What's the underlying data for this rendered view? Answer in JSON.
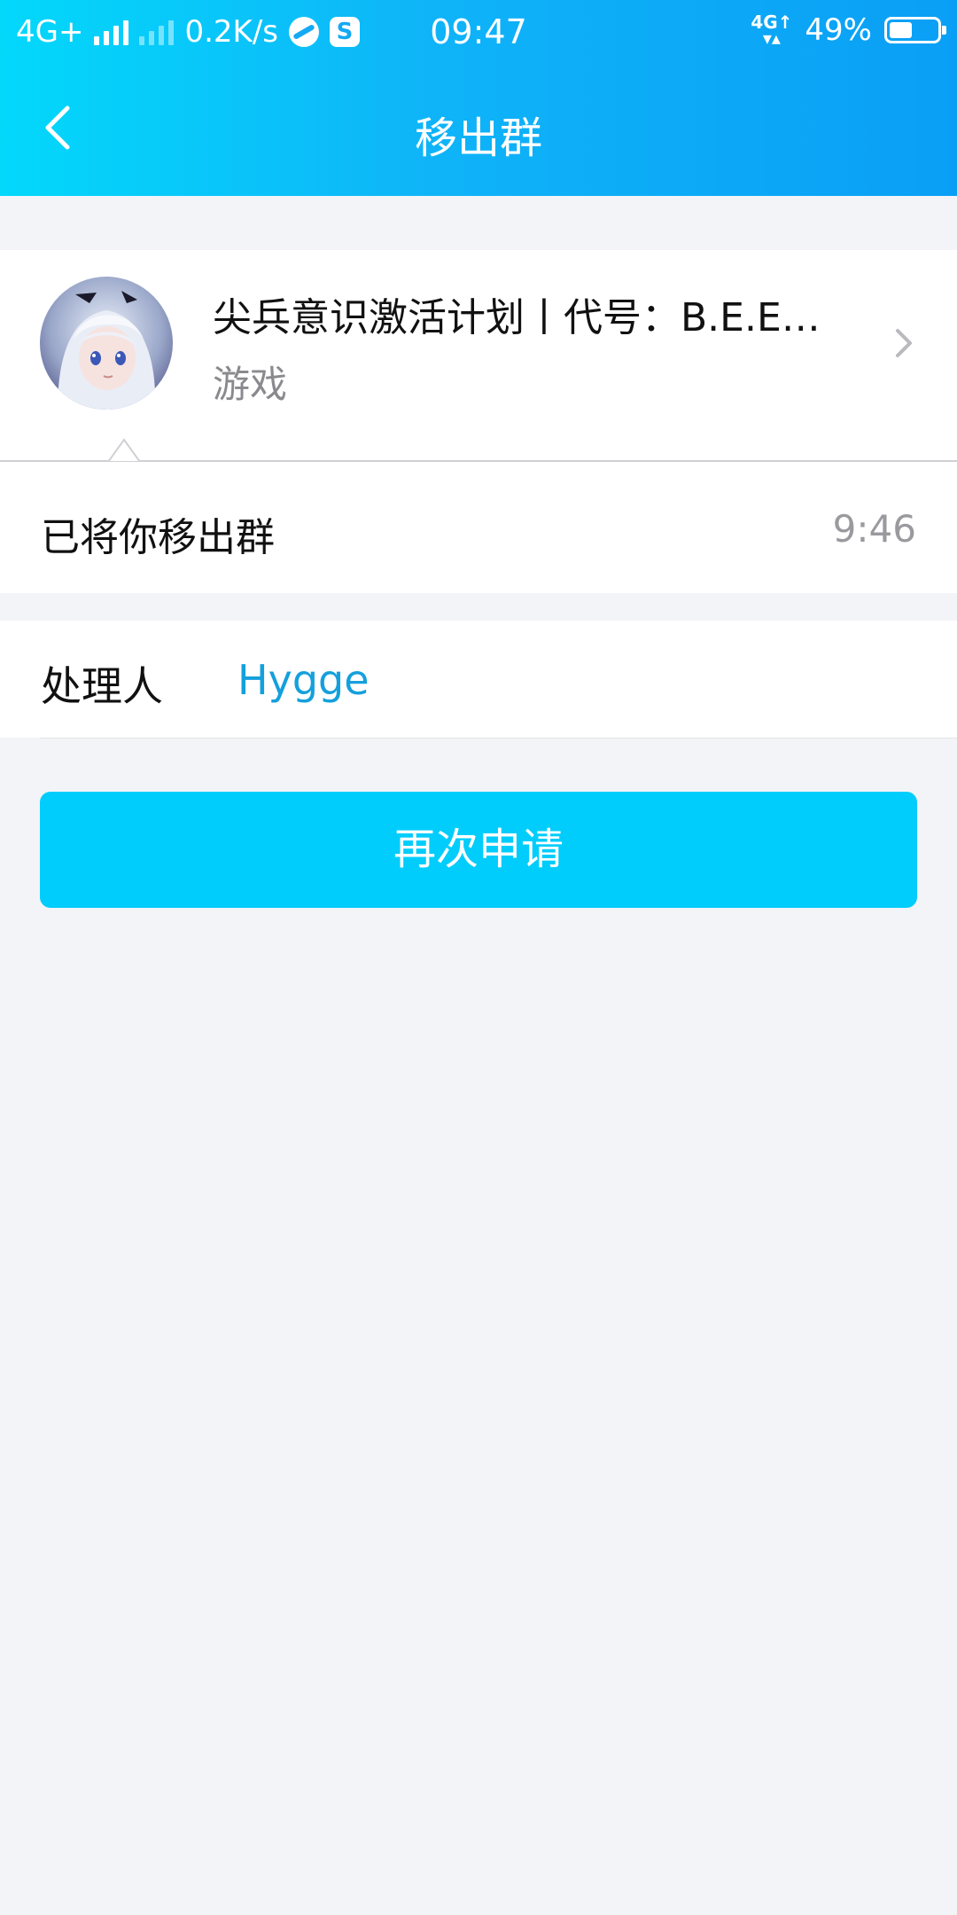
{
  "status_bar": {
    "network_left": "4G+",
    "speed": "0.2K/s",
    "app_icon_label": "S",
    "time": "09:47",
    "network_right_top": "4G↑",
    "network_right_bottom": "▾▴",
    "battery_percent": "49%",
    "battery_level": 0.49
  },
  "nav": {
    "title": "移出群",
    "back_icon": "chevron-left-icon"
  },
  "group": {
    "name": "尖兵意识激活计划丨代号：B.E.E…",
    "category": "游戏",
    "avatar": "anime-avatar",
    "chevron_icon": "chevron-right-icon"
  },
  "message": {
    "text": "已将你移出群",
    "time": "9:46"
  },
  "handler": {
    "label": "处理人",
    "name": "Hygge"
  },
  "actions": {
    "reapply_label": "再次申请"
  },
  "colors": {
    "header_start": "#03d8fb",
    "header_end": "#0a9ff6",
    "button": "#01cdfc",
    "link": "#14a0dc",
    "background": "#f3f4f8"
  }
}
